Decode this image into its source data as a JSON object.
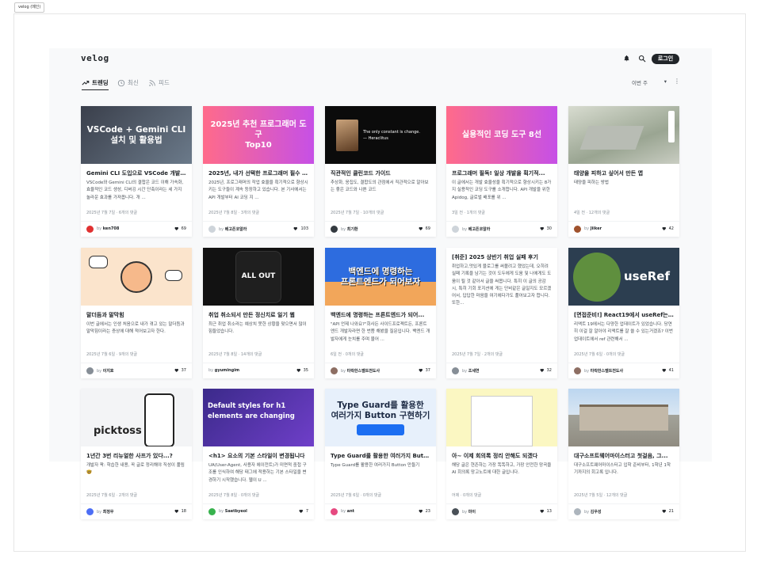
{
  "frame_tab": "velog (메인)",
  "header": {
    "logo": "velog",
    "login_label": "로그인"
  },
  "tabs": [
    {
      "label": "트렌딩",
      "icon": "trending-icon"
    },
    {
      "label": "최신",
      "icon": "clock-icon"
    },
    {
      "label": "피드",
      "icon": "rss-icon"
    }
  ],
  "period": {
    "label": "이번 주",
    "arrow": "▾"
  },
  "more_icon": "⋮",
  "cards": [
    {
      "thumb_text": "VSCode + Gemini CLI\n설치 및 활용법",
      "title": "Gemini CLI 도입으로 VSCode 개발 ...",
      "desc": "VSCode와 Gemini CLI의 결합은 코드 이해 가속화, 효율적인 코드 생성, 디버깅 시간 단축이라는 세 가지 놀라운 효과를 가져옵니다. 개 ...",
      "meta": "2025년 7월 7일 · 6개의 댓글",
      "author": "ken708",
      "likes": "69"
    },
    {
      "thumb_text": "2025년 추천 프로그래머 도구\nTop10",
      "title": "2025년, 내가 선택한 프로그래머 필수 ...",
      "desc": "2025년, 프로그래머의 작업 효율을 획기적으로 향상시키는 도구들이 계속 등장하고 있습니다. 본 기사에서는 API 개발부터 AI 코딩 지 ...",
      "meta": "2025년 7월 8일 · 3개의 댓글",
      "author": "베고픈코알라",
      "likes": "103"
    },
    {
      "thumb_text": "The only constant is change.\n— Heraclitus",
      "title": "직관적인 클린코드 가이드",
      "desc": "추상화, 응집도, 결합도의 관점에서 직관적으로 알아보는 좋은 코드와 나쁜 코드",
      "meta": "2025년 7월 7일 · 10개의 댓글",
      "author": "최기환",
      "likes": "69"
    },
    {
      "thumb_text": "실용적인 코딩 도구 8선",
      "title": "프로그래머 필독! 일상 개발을 획기적...",
      "desc": "이 글에서는 개발 효율성을 획기적으로 향상시키는 8가지 실용적인 코딩 도구를 소개합니다. API 개발을 위한 Apidog, 글로벌 배포를 위 ...",
      "meta": "3일 전 · 1개의 댓글",
      "author": "베고픈코알라",
      "likes": "30"
    },
    {
      "thumb_text": "",
      "title": "태양을 피하고 싶어서 만든 앱",
      "desc": "태양을 피하는 방법",
      "meta": "4일 전 · 12개의 댓글",
      "author": "Jiiker",
      "likes": "42"
    },
    {
      "thumb_text": "",
      "title": "말더듬과 말막힘",
      "desc": "이번 글에서는 인생 처음으로 내가 겪고 있는 말더듬과 말막힘이라는 증상에 대해 적어보고자 한다.",
      "meta": "2025년 7월 6일 · 9개의 댓글",
      "author": "이지호",
      "likes": "37"
    },
    {
      "thumb_text": "ALL OUT",
      "title": "취업 취소되서 만든 정신치료 일기 웹",
      "desc": "최근 취업 취소라는 예상치 못한 상황을 맞으면서 많이 힘들었습니다.",
      "meta": "2025년 7월 8일 · 14개의 댓글",
      "author": "gyumingim",
      "likes": "35"
    },
    {
      "thumb_text": "백엔드에 명령하는\n프론트엔드가 되어보자",
      "title": "백엔드에 명령하는 프론트엔드가 되어...",
      "desc": "\"API 언제 나와요?\"회사든 사이드프로젝트든, 프론트엔드 개발자라면 한 번쯤 해봤을 질문입니다. 백엔드 개발자에게 눈치를 주며 물어 ...",
      "meta": "6일 전 · 0개의 댓글",
      "author": "타락한스벨트전도사",
      "likes": "37"
    },
    {
      "thumb_text": "",
      "title": "[취준] 2025 상반기 취업 실패 후기",
      "desc": "취업하고,멋있게 블로그를 써볼려고 했었는데, 오히려 실패 기록을 남기는 것이 도두에게 도움 및 나에게도 도움이 될 것 같아서 글을 써봅니다. 특히 이 글의 공감 시, 특히 기회 포지션에 게는 단비같은 글일지도 모르겠어서, 답답한 마음을 여기에다가도 풀어보고자 합니다. 또한...",
      "meta": "2025년 7월 7일 · 2개의 댓글",
      "author": "조세연",
      "likes": "32"
    },
    {
      "thumb_text": "useRef",
      "title": "[면접준비!] React19에서 useRef는 ...",
      "desc": "리액트 19에서는 다양한 업데이트가 있었습니다. 당연히 이걸 잘 알아야 리액트를 잘 쓸 수 있는거겠죠? 이번업데이트에서 ref 관련해서 ...",
      "meta": "2025년 7월 6일 · 0개의 댓글",
      "author": "타락한스벨트전도사",
      "likes": "41"
    },
    {
      "thumb_text": "picktoss",
      "title": "1년간 3번 리뉴얼한 사프가 있다...?",
      "desc": "개발자 팍: 학습한 내용, 꼭 글로 정리해야 직성이 풀림🤓",
      "meta": "2025년 7월 6일 · 2개의 댓글",
      "author": "최정우",
      "likes": "18"
    },
    {
      "thumb_text": "Default styles for h1\nelements are changing",
      "title": "<h1> 요소의 기본 스타일이 변경됩니다",
      "desc": "UA(User-Agent, 사용자 에이전트)가 미면적 중첩 구조를 인식하여 해당 태그에 적용하는 기본 스타일을 변경하기 시작했습니다. 웹이 U ...",
      "meta": "2025년 7월 8일 · 0개의 댓글",
      "author": "Saetbyeol",
      "likes": "7"
    },
    {
      "thumb_text": "Type Guard를 활용한\n여러가지 Button 구현하기",
      "title": "Type Guard를 활용한 여러가지 Butto...",
      "desc": "Type Guard를 활용한 여러가지 Button 만들기",
      "meta": "2025년 7월 6일 · 0개의 댓글",
      "author": "ant",
      "likes": "23"
    },
    {
      "thumb_text": "",
      "title": "아~ 이제 회의록 정리 안해도 되겠다",
      "desc": "해당 글은 현존하는 가장 똑똑하고, 가장 안전한 망곡을 AI 회의록 망고노트에 대한 글입니다.",
      "meta": "어제 · 0개의 댓글",
      "author": "마이",
      "likes": "13"
    },
    {
      "thumb_text": "",
      "title": "대구소프트웨어마이스터고 첫걸음, 그...",
      "desc": "대구소프트웨어마이스터고 입학 준비부터, 1학년 1학기까지의 회고록 입니다.",
      "meta": "2025년 7월 5일 · 12개의 댓글",
      "author": "김우성",
      "likes": "21"
    }
  ],
  "colors": {
    "accent": "#212529",
    "muted": "#868e96",
    "background": "#f8f9fa"
  }
}
